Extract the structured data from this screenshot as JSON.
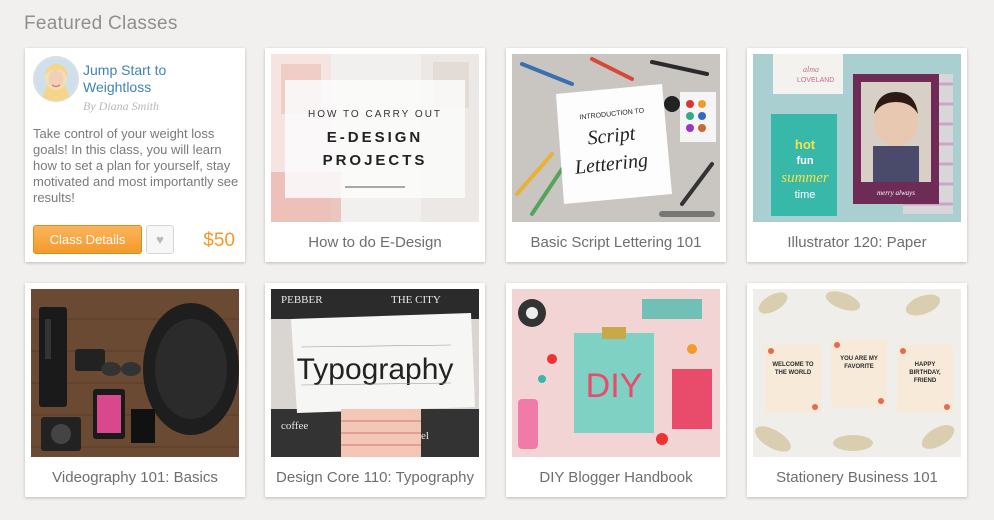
{
  "section": {
    "title": "Featured Classes"
  },
  "detail_card": {
    "title": "Jump Start to Weightloss",
    "author": "By Diana Smith",
    "description": "Take control of your weight loss goals! In this class, you will learn how to set a plan for yourself, stay motivated and most importantly see results!",
    "details_button": "Class Details",
    "heart_icon": "heart-icon",
    "price": "$50"
  },
  "classes": [
    {
      "title": "How to do E-Design",
      "image_text": [
        "HOW TO CARRY OUT",
        "E-DESIGN",
        "PROJECTS"
      ]
    },
    {
      "title": "Basic Script Lettering 101",
      "image_text": [
        "INTRODUCTION TO",
        "Script",
        "Lettering"
      ]
    },
    {
      "title": "Illustrator 120: Paper",
      "image_text": [
        "alma",
        "LOVELAND",
        "hot",
        "fun",
        "summer",
        "time",
        "merry always"
      ]
    },
    {
      "title": "Videography 101: Basics"
    },
    {
      "title": "Design Core 110: Typography",
      "image_text": [
        "Typography"
      ]
    },
    {
      "title": "DIY Blogger Handbook",
      "image_text": [
        "DIY"
      ]
    },
    {
      "title": "Stationery Business 101",
      "image_text": [
        "WELCOME TO THE WORLD",
        "YOU ARE MY FAVORITE",
        "HAPPY BIRTHDAY, FRIEND"
      ]
    }
  ],
  "colors": {
    "accent": "#f39a2c",
    "link": "#3e84b6",
    "text": "#6e6e6e"
  }
}
